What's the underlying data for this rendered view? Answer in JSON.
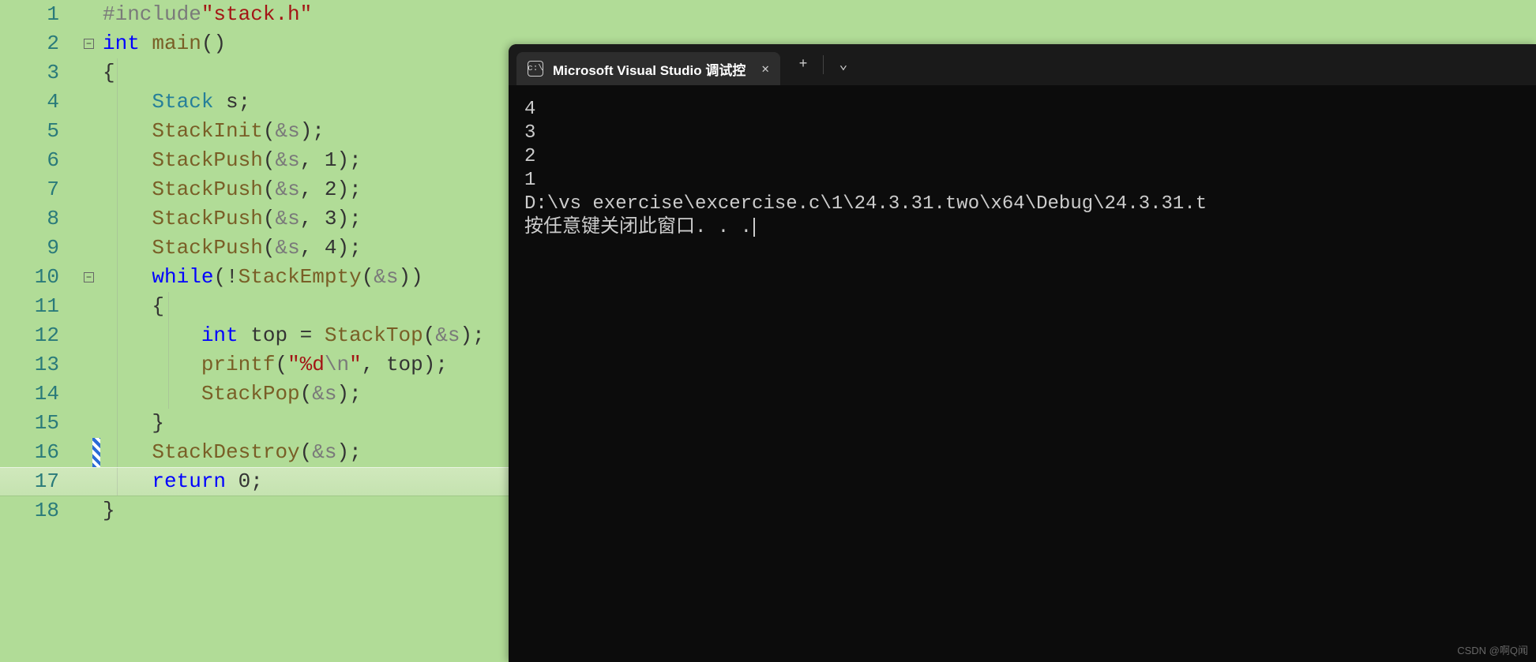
{
  "editor": {
    "lines": [
      {
        "num": "1"
      },
      {
        "num": "2"
      },
      {
        "num": "3"
      },
      {
        "num": "4"
      },
      {
        "num": "5"
      },
      {
        "num": "6"
      },
      {
        "num": "7"
      },
      {
        "num": "8"
      },
      {
        "num": "9"
      },
      {
        "num": "10"
      },
      {
        "num": "11"
      },
      {
        "num": "12"
      },
      {
        "num": "13"
      },
      {
        "num": "14"
      },
      {
        "num": "15"
      },
      {
        "num": "16"
      },
      {
        "num": "17"
      },
      {
        "num": "18"
      }
    ],
    "tokens": {
      "include": "#include",
      "stackh": "\"stack.h\"",
      "int": "int",
      "main": "main",
      "stack_type": "Stack",
      "var_s": "s",
      "stackinit": "StackInit",
      "stackpush": "StackPush",
      "amp_s": "&s",
      "n1": "1",
      "n2": "2",
      "n3": "3",
      "n4": "4",
      "while": "while",
      "not": "!",
      "stackempty": "StackEmpty",
      "top_var": "top",
      "eq": " = ",
      "stacktop": "StackTop",
      "printf": "printf",
      "fmtstr_open": "\"",
      "fmtstr_d": "%d",
      "fmtstr_esc": "\\n",
      "fmtstr_close": "\"",
      "top_arg": "top",
      "stackpop": "StackPop",
      "stackdestroy": "StackDestroy",
      "return": "return",
      "zero": "0",
      "lbrace": "{",
      "rbrace": "}",
      "lparen": "(",
      "rparen": ")",
      "parens": "()",
      "semi": ";",
      "comma": ", ",
      "fold_minus": "−"
    }
  },
  "terminal": {
    "tab_title": "Microsoft Visual Studio 调试控",
    "output": [
      "4",
      "3",
      "2",
      "1",
      "",
      "D:\\vs exercise\\excercise.c\\1\\24.3.31.two\\x64\\Debug\\24.3.31.t",
      "按任意键关闭此窗口. . ."
    ]
  },
  "watermark": "CSDN @啊Q闻"
}
